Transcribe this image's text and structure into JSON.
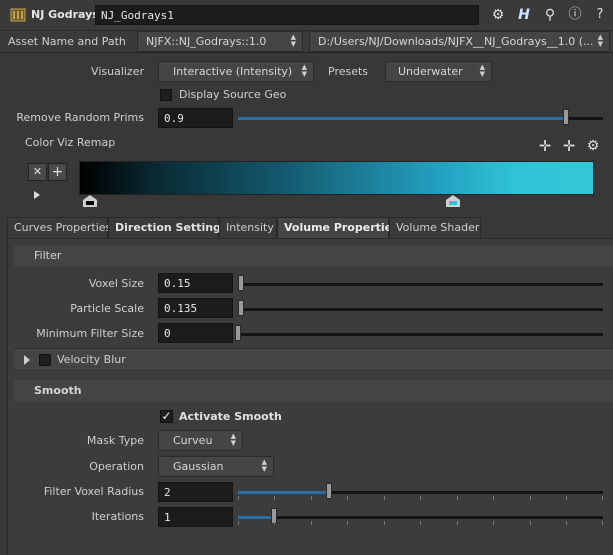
{
  "header": {
    "node_type": "NJ Godrays",
    "node_name": "NJ_Godrays1",
    "icons": [
      "gear-icon",
      "help-h-icon",
      "search-icon",
      "info-icon",
      "question-icon"
    ]
  },
  "asset": {
    "label": "Asset Name and Path",
    "name": "NJFX::NJ_Godrays::1.0",
    "path": "D:/Users/NJ/Downloads/NJFX__NJ_Godrays__1.0 (..."
  },
  "params": {
    "visualizer_label": "Visualizer",
    "visualizer_value": "Interactive (Intensity)",
    "presets_label": "Presets",
    "presets_value": "Underwater",
    "display_source_geo": "Display Source Geo",
    "remove_random_label": "Remove Random Prims",
    "remove_random_value": "0.9",
    "remove_random_fraction": 0.9,
    "color_remap_label": "Color Viz Remap",
    "ramp_colors": [
      "#000000",
      "#2ec4d8"
    ]
  },
  "tabs": [
    "Curves Properties",
    "Direction Settings",
    "Intensity",
    "Volume Properties",
    "Volume Shader"
  ],
  "filter": {
    "title": "Filter",
    "voxel_size_label": "Voxel Size",
    "voxel_size_value": "0.15",
    "particle_scale_label": "Particle Scale",
    "particle_scale_value": "0.135",
    "min_filter_label": "Minimum Filter Size",
    "min_filter_value": "0",
    "velocity_blur": "Velocity Blur"
  },
  "smooth": {
    "title": "Smooth",
    "activate_label": "Activate Smooth",
    "mask_type_label": "Mask Type",
    "mask_type_value": "Curveu",
    "operation_label": "Operation",
    "operation_value": "Gaussian",
    "filter_voxel_radius_label": "Filter Voxel Radius",
    "filter_voxel_radius_value": "2",
    "iterations_label": "Iterations",
    "iterations_value": "1"
  }
}
